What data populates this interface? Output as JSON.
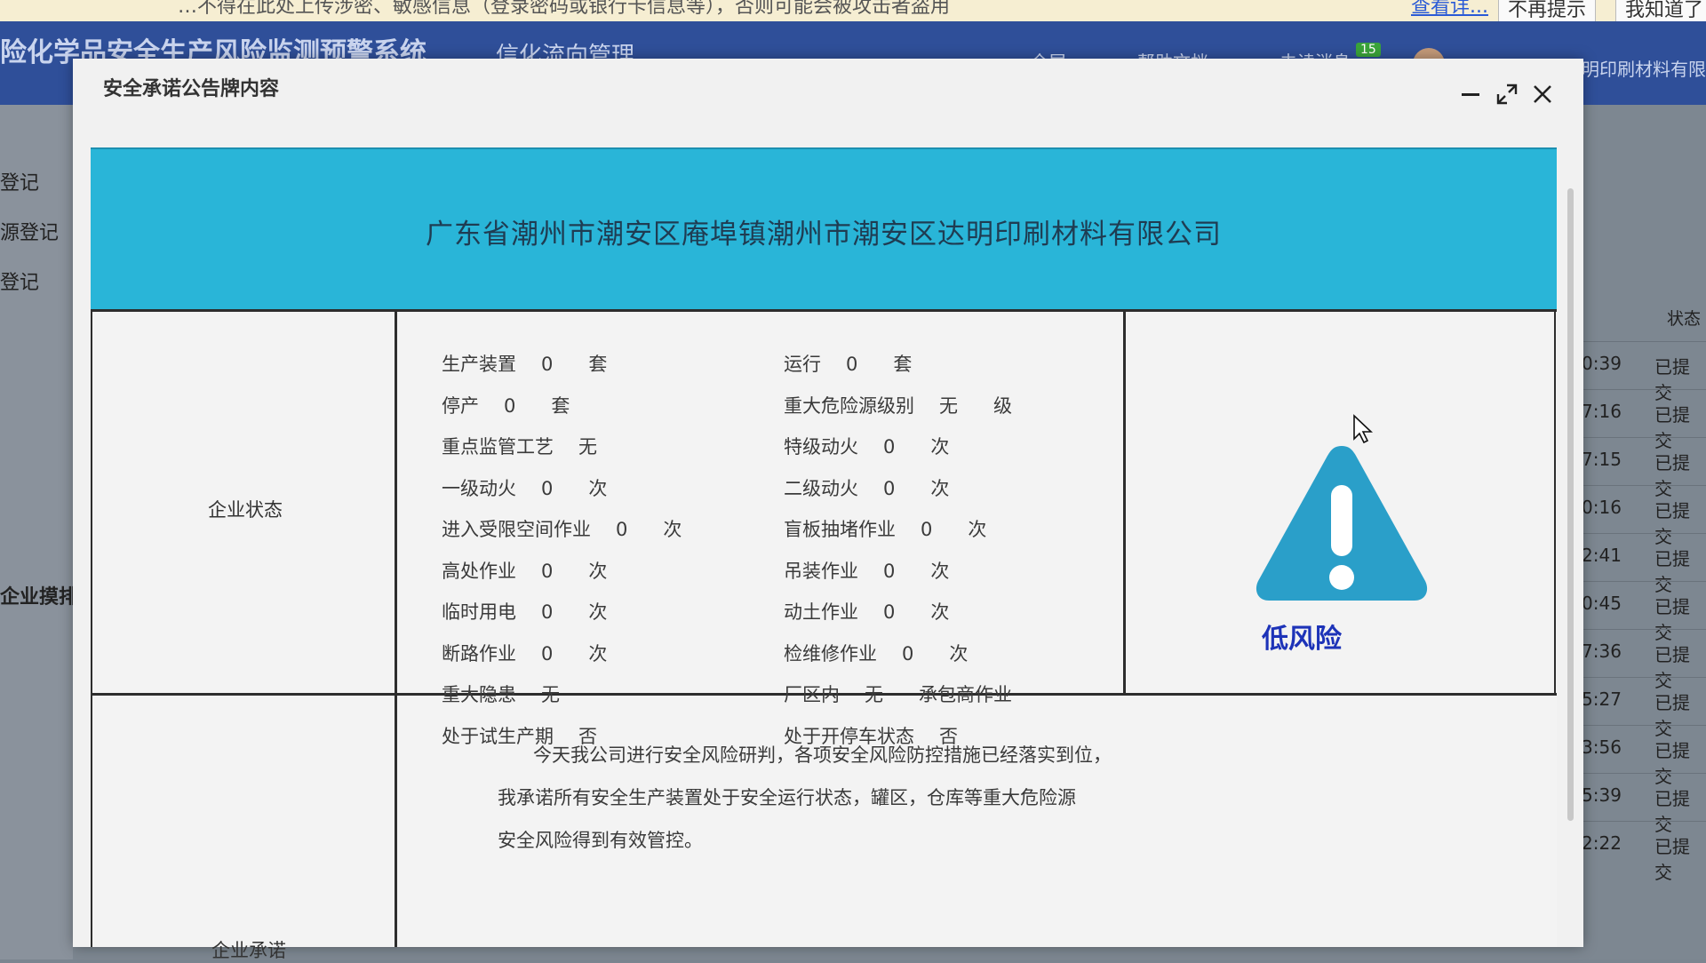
{
  "notice": {
    "text": "…不得在此处上传涉密、敏感信息（登录密码或银行卡信息等），否则可能会被攻击者盗用",
    "more_link": "查看详...",
    "btn_no_remind": "不再提示",
    "btn_know": "我知道了"
  },
  "app_header": {
    "title": "险化学品安全生产风险监测预警系统",
    "subtitle": "信化流向管理",
    "items": [
      "全屏",
      "帮助文档",
      "未读消息"
    ],
    "badge": "15",
    "user": "潮州市潮安区达明印刷材料有限"
  },
  "sidebar": {
    "items": [
      "登记",
      "源登记",
      "登记",
      "企业摸排"
    ]
  },
  "bg_table": {
    "header": "状态",
    "rows": [
      {
        "time": "0:39",
        "status": "已提交"
      },
      {
        "time": "7:16",
        "status": "已提交"
      },
      {
        "time": "7:15",
        "status": "已提交"
      },
      {
        "time": "0:16",
        "status": "已提交"
      },
      {
        "time": "2:41",
        "status": "已提交"
      },
      {
        "time": "0:45",
        "status": "已提交"
      },
      {
        "time": "7:36",
        "status": "已提交"
      },
      {
        "time": "5:27",
        "status": "已提交"
      },
      {
        "time": "3:56",
        "status": "已提交"
      },
      {
        "time": "5:39",
        "status": "已提交"
      },
      {
        "time": "2:22",
        "status": "已提交"
      }
    ]
  },
  "modal": {
    "title": "安全承诺公告牌内容",
    "company_name": "广东省潮州市潮安区庵埠镇潮州市潮安区达明印刷材料有限公司",
    "status_label": "企业状态",
    "commitment_label": "企业承诺",
    "risk_level": "低风险",
    "status_left": [
      {
        "key": "生产装置",
        "value": "0",
        "unit": "套"
      },
      {
        "key": "停产",
        "value": "0",
        "unit": "套"
      },
      {
        "key": "重点监管工艺",
        "value": "无",
        "unit": ""
      },
      {
        "key": "一级动火",
        "value": "0",
        "unit": "次"
      },
      {
        "key": "进入受限空间作业",
        "value": "0",
        "unit": "次"
      },
      {
        "key": "高处作业",
        "value": "0",
        "unit": "次"
      },
      {
        "key": "临时用电",
        "value": "0",
        "unit": "次"
      },
      {
        "key": "断路作业",
        "value": "0",
        "unit": "次"
      },
      {
        "key": "重大隐患",
        "value": "无",
        "unit": ""
      },
      {
        "key": "处于试生产期",
        "value": "否",
        "unit": ""
      }
    ],
    "status_right": [
      {
        "key": "运行",
        "value": "0",
        "unit": "套"
      },
      {
        "key": "重大危险源级别",
        "value": "无",
        "unit": "级"
      },
      {
        "key": "特级动火",
        "value": "0",
        "unit": "次"
      },
      {
        "key": "二级动火",
        "value": "0",
        "unit": "次"
      },
      {
        "key": "盲板抽堵作业",
        "value": "0",
        "unit": "次"
      },
      {
        "key": "吊装作业",
        "value": "0",
        "unit": "次"
      },
      {
        "key": "动土作业",
        "value": "0",
        "unit": "次"
      },
      {
        "key": "检维修作业",
        "value": "0",
        "unit": "次"
      },
      {
        "key": "厂区内",
        "value": "无",
        "unit": "承包商作业"
      },
      {
        "key": "处于开停车状态",
        "value": "否",
        "unit": ""
      }
    ],
    "commitment_lines": [
      "今天我公司进行安全风险研判，各项安全风险防控措施已经落实到位，",
      "我承诺所有安全生产装置处于安全运行状态，罐区，仓库等重大危险源",
      "安全风险得到有效管控。"
    ],
    "colors": {
      "banner": "#29b5d8",
      "warning_icon": "#2a9fc9",
      "risk_text": "#1d33b8"
    }
  }
}
